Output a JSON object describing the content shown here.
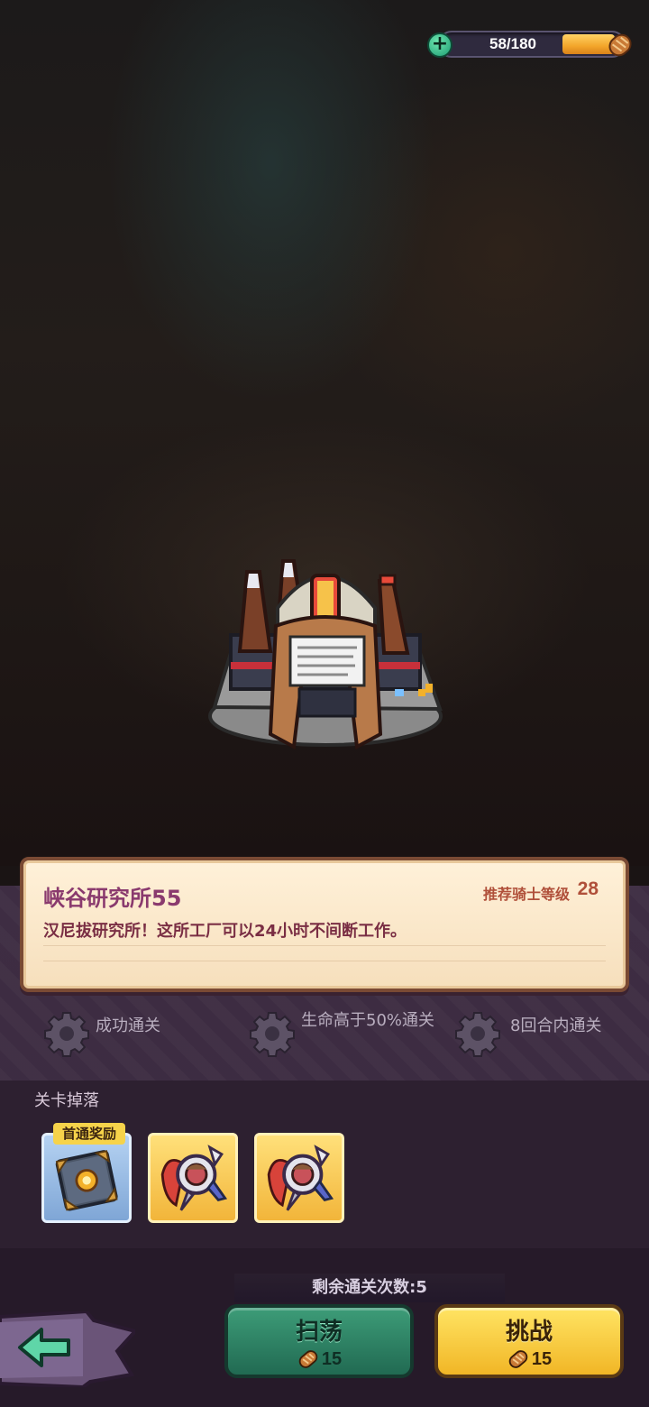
{
  "stamina": {
    "value_text": "58/180",
    "fraction": 0.32
  },
  "stage": {
    "title": "峡谷研究所55",
    "recommend_label": "推荐骑士等级",
    "recommend_level": "28",
    "description": "汉尼拔研究所！这所工厂可以24小时不间断工作。"
  },
  "objectives": [
    {
      "text": "成功通关",
      "icon": "gear-icon"
    },
    {
      "text": "生命高于50%通关",
      "icon": "gear-icon"
    },
    {
      "text": "8回合内通关",
      "icon": "gear-icon"
    }
  ],
  "drops": {
    "label": "关卡掉落",
    "first_clear_badge": "首通奖励",
    "items": [
      {
        "icon": "spellbook-icon",
        "frame": "first-clear"
      },
      {
        "icon": "eye-shield-icon",
        "frame": "gold"
      },
      {
        "icon": "eye-shield-icon",
        "frame": "gold"
      }
    ]
  },
  "bottom": {
    "remaining": "剩余通关次数:5",
    "sweep_label": "扫荡",
    "sweep_cost": "15",
    "challenge_label": "挑战",
    "challenge_cost": "15"
  },
  "colors": {
    "accent_gold": "#f3b12a",
    "accent_green": "#2f8a68",
    "title_purple": "#8a3a6e"
  }
}
